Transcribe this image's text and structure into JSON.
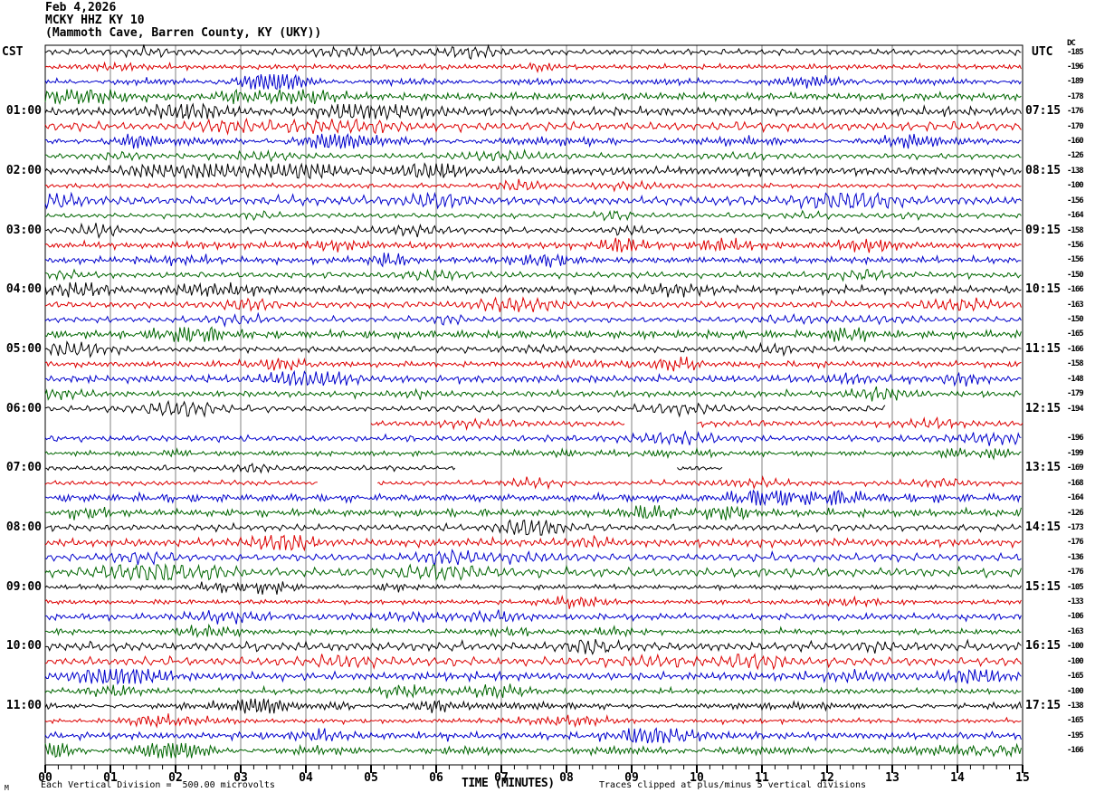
{
  "header": {
    "date": "Feb 4,2026",
    "station_id": "MCKY HHZ KY 10",
    "station_location": "(Mammoth Cave, Barren County, KY (UKY))"
  },
  "axis": {
    "left_timezone": "CST",
    "right_timezone": "UTC",
    "dc_header": "DC",
    "left_hour_labels": [
      "01:00",
      "02:00",
      "03:00",
      "04:00",
      "05:00",
      "06:00",
      "07:00",
      "08:00",
      "09:00",
      "10:00",
      "11:00"
    ],
    "right_hour_labels": [
      "07:15",
      "08:15",
      "09:15",
      "10:15",
      "11:15",
      "12:15",
      "13:15",
      "14:15",
      "15:15",
      "16:15",
      "17:15"
    ],
    "x_tick_labels": [
      "00",
      "01",
      "02",
      "03",
      "04",
      "05",
      "06",
      "07",
      "08",
      "09",
      "10",
      "11",
      "12",
      "13",
      "14",
      "15"
    ],
    "x_axis_title": "TIME (MINUTES)"
  },
  "footer": {
    "scale_note": "Each Vertical Division =  500.00 microvolts",
    "clip_note": "Traces clipped at plus/minus 5 vertical divisions",
    "corner_mark": "M"
  },
  "chart_data": {
    "type": "line",
    "description": "Helicorder seismogram, 48 trace rows of 15 minutes each, 4 rows per hour, colors cycling black/red/blue/green",
    "x_range_minutes": [
      0,
      15
    ],
    "minutes_per_row": 15,
    "rows_per_hour": 4,
    "num_rows": 48,
    "trace_color_cycle": [
      "#000000",
      "#dd0000",
      "#0000cc",
      "#006600"
    ],
    "grid_color": "#808080",
    "border_color": "#000000",
    "dc_offsets": [
      "-185",
      "-196",
      "-189",
      "-178",
      "-176",
      "-170",
      "-160",
      "-126",
      "-138",
      "-100",
      "-156",
      "-164",
      "-158",
      "-156",
      "-156",
      "-150",
      "-166",
      "-163",
      "-150",
      "-165",
      "-166",
      "-158",
      "-148",
      "-179",
      "-194",
      "",
      "-196",
      "-199",
      "-169",
      "-168",
      "-164",
      "-126",
      "-173",
      "-176",
      "-136",
      "-176",
      "-105",
      "-133",
      "-106",
      "-163",
      "-100",
      "-100",
      "-165",
      "-100",
      "-138",
      "-165",
      "-195",
      "-166"
    ],
    "row_segments_minutes": {
      "24": [
        [
          0,
          12.9
        ]
      ],
      "25": [
        [
          5.0,
          8.9
        ],
        [
          10.0,
          15
        ]
      ],
      "28": [
        [
          0,
          6.3
        ],
        [
          9.7,
          10.4
        ]
      ],
      "29": [
        [
          0,
          4.2
        ],
        [
          5.1,
          15
        ]
      ]
    }
  }
}
